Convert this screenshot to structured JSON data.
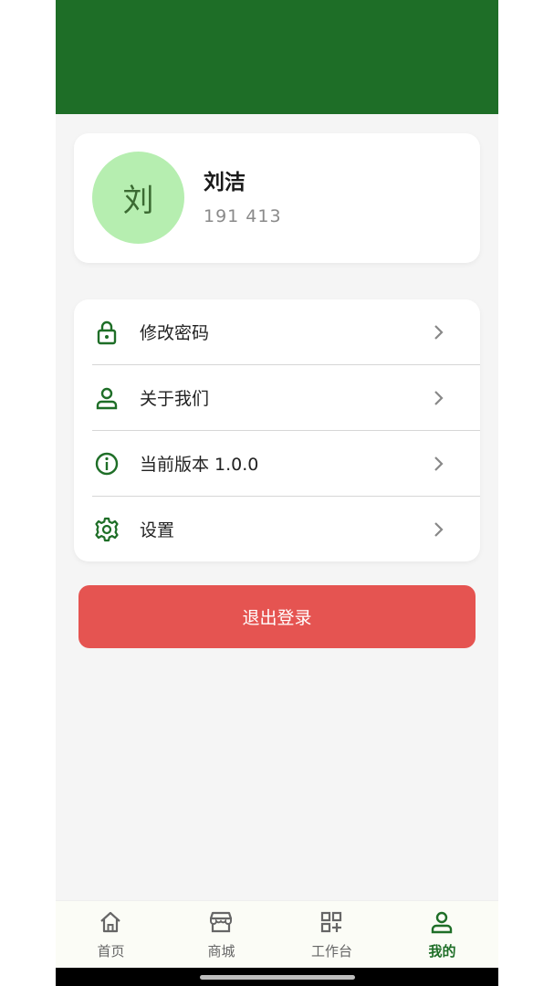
{
  "colors": {
    "header_bg": "#1e6e27",
    "accent": "#1e6e27",
    "avatar_bg": "#b6eeb0",
    "avatar_text": "#3b6a32",
    "logout_bg": "#e55451"
  },
  "profile": {
    "avatar_char": "刘",
    "name": "刘洁",
    "phone": "191 413"
  },
  "menu": {
    "items": [
      {
        "icon": "lock-icon",
        "label": "修改密码"
      },
      {
        "icon": "user-icon",
        "label": "关于我们"
      },
      {
        "icon": "info-icon",
        "label": "当前版本  1.0.0"
      },
      {
        "icon": "gear-icon",
        "label": "设置"
      }
    ]
  },
  "logout": {
    "label": "退出登录"
  },
  "tabbar": {
    "tabs": [
      {
        "icon": "home-icon",
        "label": "首页"
      },
      {
        "icon": "store-icon",
        "label": "商城"
      },
      {
        "icon": "grid-plus-icon",
        "label": "工作台"
      },
      {
        "icon": "user-icon",
        "label": "我的"
      }
    ],
    "active_index": 3
  }
}
